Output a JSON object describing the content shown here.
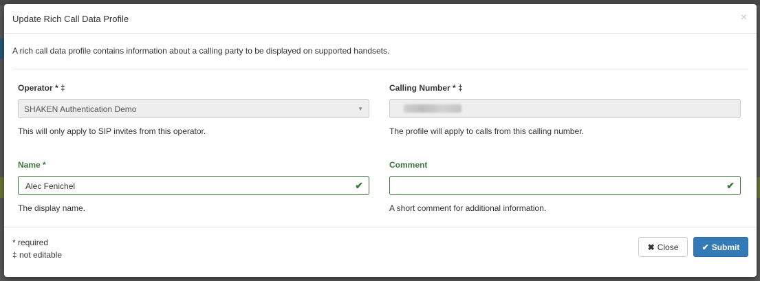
{
  "modal": {
    "title": "Update Rich Call Data Profile",
    "close_glyph": "×",
    "intro": "A rich call data profile contains information about a calling party to be displayed on supported handsets."
  },
  "fields": {
    "operator": {
      "label": "Operator * ‡",
      "value": "SHAKEN Authentication Demo",
      "help": "This will only apply to SIP invites from this operator."
    },
    "calling_number": {
      "label": "Calling Number * ‡",
      "help": "The profile will apply to calls from this calling number."
    },
    "name": {
      "label": "Name *",
      "value": "Alec Fenichel",
      "help": "The display name."
    },
    "comment": {
      "label": "Comment",
      "value": "",
      "help": "A short comment for additional information."
    }
  },
  "legend": {
    "required": "* required",
    "not_editable": "‡ not editable"
  },
  "buttons": {
    "close_label": "Close",
    "submit_label": "Submit"
  },
  "icons": {
    "close": "times-icon",
    "submit": "check-icon",
    "valid": "check-icon",
    "dropdown": "caret-down-icon"
  },
  "colors": {
    "success": "#3c763d",
    "primary": "#337ab7",
    "disabled_bg": "#eeeeee"
  }
}
